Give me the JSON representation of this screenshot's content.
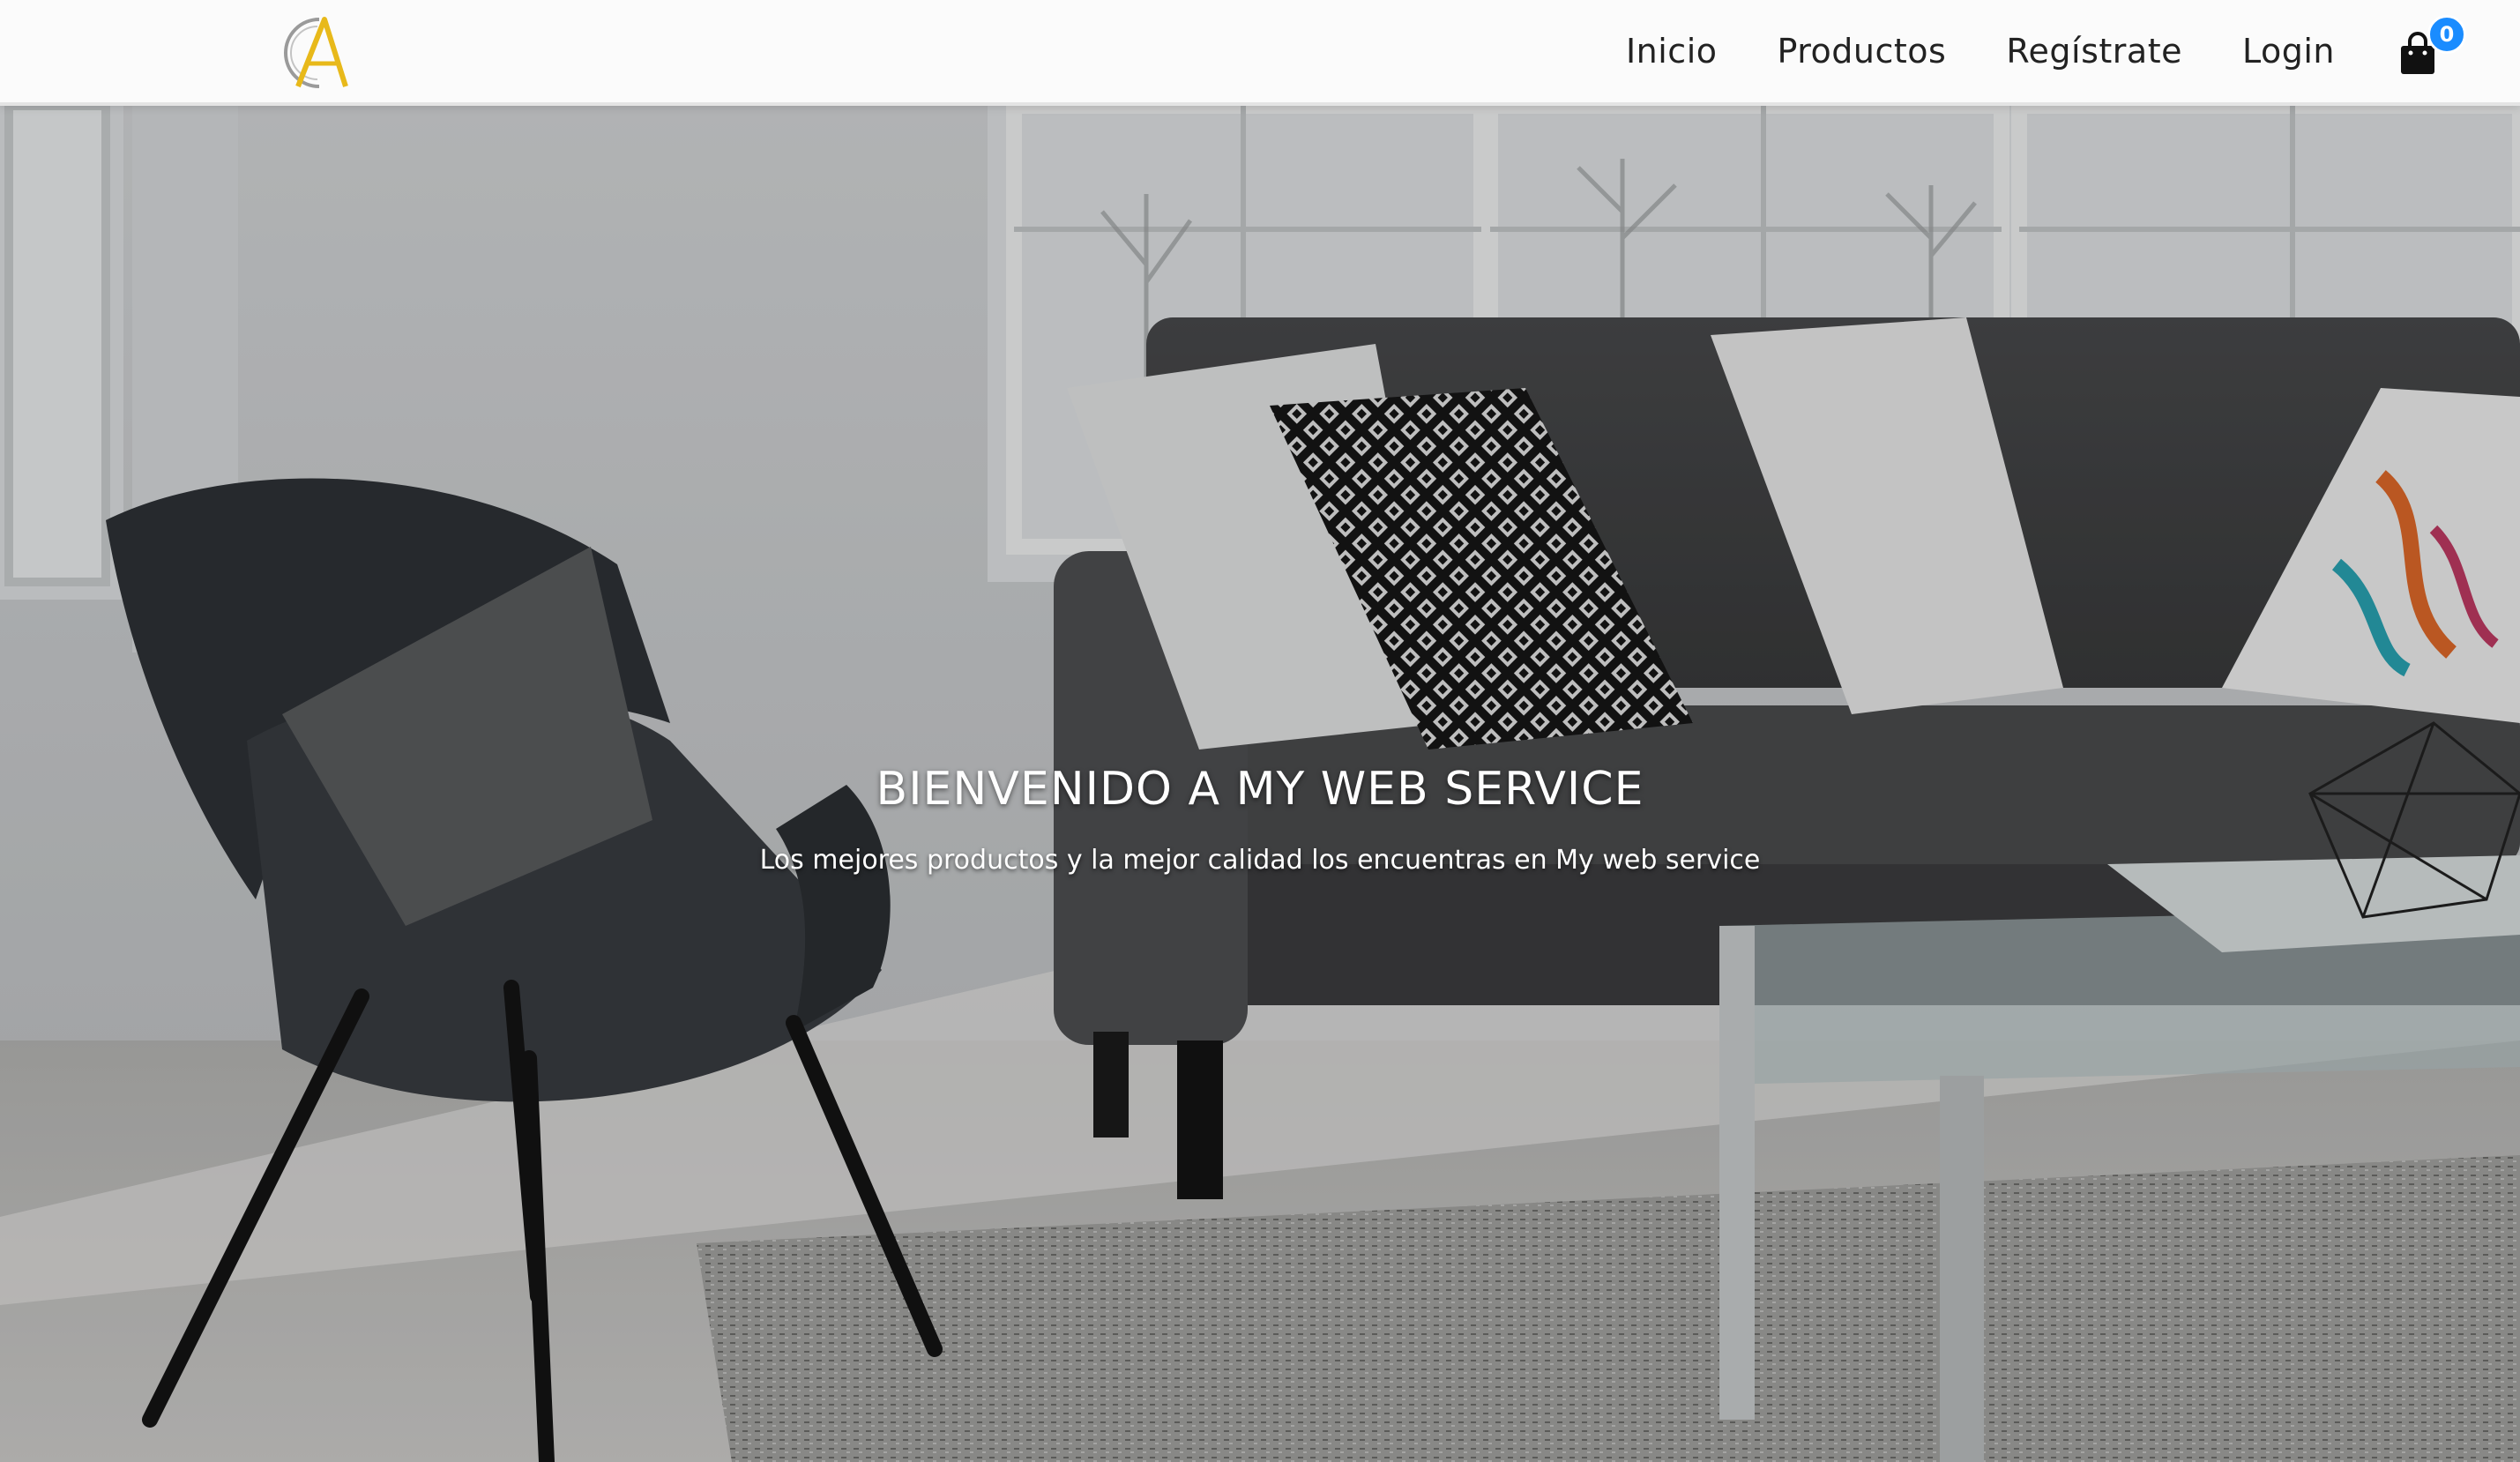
{
  "header": {
    "logo_icon": "ca-monogram-logo",
    "nav": [
      {
        "label": "Inicio"
      },
      {
        "label": "Productos"
      },
      {
        "label": "Regístrate"
      },
      {
        "label": "Login"
      }
    ],
    "cart": {
      "icon": "shopping-bag-icon",
      "count": "0",
      "badge_color": "#1a8cff"
    }
  },
  "hero": {
    "title": "BIENVENIDO A MY WEB SERVICE",
    "subtitle": "Los mejores productos y la mejor calidad los encuentras en My web service"
  },
  "colors": {
    "logo_gold": "#e8b91a",
    "logo_gray": "#9a9a9a",
    "nav_text": "#222222"
  }
}
